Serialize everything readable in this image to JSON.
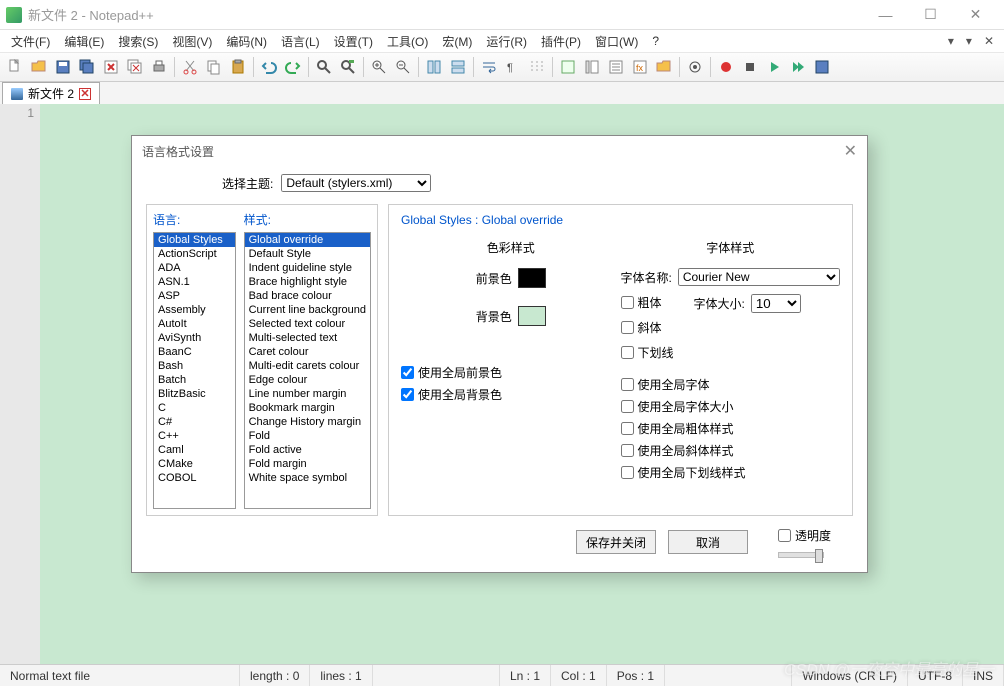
{
  "window": {
    "title": "新文件 2 - Notepad++"
  },
  "menu": {
    "items": [
      "文件(F)",
      "编辑(E)",
      "搜索(S)",
      "视图(V)",
      "编码(N)",
      "语言(L)",
      "设置(T)",
      "工具(O)",
      "宏(M)",
      "运行(R)",
      "插件(P)",
      "窗口(W)",
      "?"
    ]
  },
  "tab": {
    "name": "新文件 2"
  },
  "gutter": {
    "line": "1"
  },
  "status": {
    "type": "Normal text file",
    "length": "length : 0",
    "lines": "lines : 1",
    "ln": "Ln : 1",
    "col": "Col : 1",
    "pos": "Pos : 1",
    "eol": "Windows (CR LF)",
    "enc": "UTF-8",
    "ins": "INS"
  },
  "watermark": "CSDN @一夜空中最亮的星一",
  "dialog": {
    "title": "语言格式设置",
    "theme_label": "选择主题:",
    "theme_value": "Default (stylers.xml)",
    "lang_label": "语言:",
    "style_label": "样式:",
    "languages": [
      "Global Styles",
      "ActionScript",
      "ADA",
      "ASN.1",
      "ASP",
      "Assembly",
      "AutoIt",
      "AviSynth",
      "BaanC",
      "Bash",
      "Batch",
      "BlitzBasic",
      "C",
      "C#",
      "C++",
      "Caml",
      "CMake",
      "COBOL"
    ],
    "styles": [
      "Global override",
      "Default Style",
      "Indent guideline style",
      "Brace highlight style",
      "Bad brace colour",
      "Current line background",
      "Selected text colour",
      "Multi-selected text",
      "Caret colour",
      "Multi-edit carets colour",
      "Edge colour",
      "Line number margin",
      "Bookmark margin",
      "Change History margin",
      "Fold",
      "Fold active",
      "Fold margin",
      "White space symbol"
    ],
    "right_title": "Global Styles : Global override",
    "color_section": "色彩样式",
    "fg_label": "前景色",
    "bg_label": "背景色",
    "use_global_fg": "使用全局前景色",
    "use_global_bg": "使用全局背景色",
    "font_section": "字体样式",
    "font_name_label": "字体名称:",
    "font_name": "Courier New",
    "bold": "粗体",
    "italic": "斜体",
    "underline": "下划线",
    "font_size_label": "字体大小:",
    "font_size": "10",
    "use_global_font": "使用全局字体",
    "use_global_font_size": "使用全局字体大小",
    "use_global_bold": "使用全局粗体样式",
    "use_global_italic": "使用全局斜体样式",
    "use_global_underline": "使用全局下划线样式",
    "btn_save": "保存并关闭",
    "btn_cancel": "取消",
    "transparent": "透明度"
  }
}
